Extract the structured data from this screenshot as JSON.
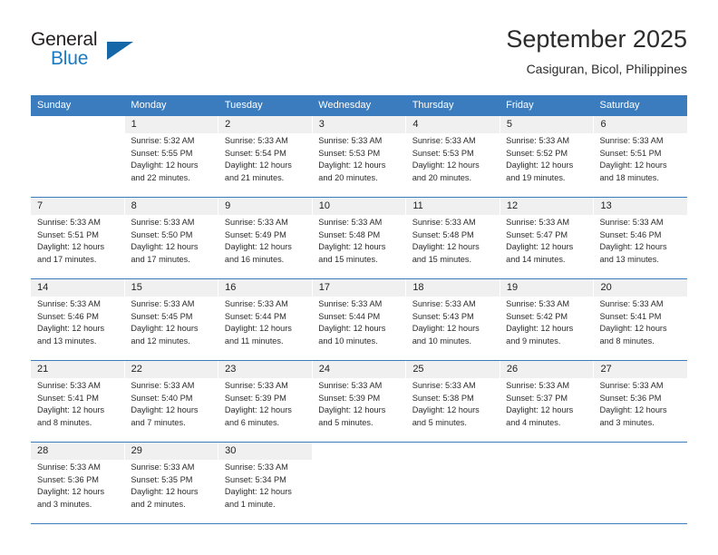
{
  "brand": {
    "word1": "General",
    "word2": "Blue",
    "triangle_color": "#1567a8",
    "blue_color": "#1c7ac0"
  },
  "header": {
    "title": "September 2025",
    "subtitle": "Casiguran, Bicol, Philippines"
  },
  "theme": {
    "header_band": "#3a7cbe",
    "daynum_band": "#f0f0f0",
    "text": "#2b2b2b"
  },
  "weekdays": [
    "Sunday",
    "Monday",
    "Tuesday",
    "Wednesday",
    "Thursday",
    "Friday",
    "Saturday"
  ],
  "weeks": [
    [
      {
        "day": "",
        "lines": []
      },
      {
        "day": "1",
        "lines": [
          "Sunrise: 5:32 AM",
          "Sunset: 5:55 PM",
          "Daylight: 12 hours",
          "and 22 minutes."
        ]
      },
      {
        "day": "2",
        "lines": [
          "Sunrise: 5:33 AM",
          "Sunset: 5:54 PM",
          "Daylight: 12 hours",
          "and 21 minutes."
        ]
      },
      {
        "day": "3",
        "lines": [
          "Sunrise: 5:33 AM",
          "Sunset: 5:53 PM",
          "Daylight: 12 hours",
          "and 20 minutes."
        ]
      },
      {
        "day": "4",
        "lines": [
          "Sunrise: 5:33 AM",
          "Sunset: 5:53 PM",
          "Daylight: 12 hours",
          "and 20 minutes."
        ]
      },
      {
        "day": "5",
        "lines": [
          "Sunrise: 5:33 AM",
          "Sunset: 5:52 PM",
          "Daylight: 12 hours",
          "and 19 minutes."
        ]
      },
      {
        "day": "6",
        "lines": [
          "Sunrise: 5:33 AM",
          "Sunset: 5:51 PM",
          "Daylight: 12 hours",
          "and 18 minutes."
        ]
      }
    ],
    [
      {
        "day": "7",
        "lines": [
          "Sunrise: 5:33 AM",
          "Sunset: 5:51 PM",
          "Daylight: 12 hours",
          "and 17 minutes."
        ]
      },
      {
        "day": "8",
        "lines": [
          "Sunrise: 5:33 AM",
          "Sunset: 5:50 PM",
          "Daylight: 12 hours",
          "and 17 minutes."
        ]
      },
      {
        "day": "9",
        "lines": [
          "Sunrise: 5:33 AM",
          "Sunset: 5:49 PM",
          "Daylight: 12 hours",
          "and 16 minutes."
        ]
      },
      {
        "day": "10",
        "lines": [
          "Sunrise: 5:33 AM",
          "Sunset: 5:48 PM",
          "Daylight: 12 hours",
          "and 15 minutes."
        ]
      },
      {
        "day": "11",
        "lines": [
          "Sunrise: 5:33 AM",
          "Sunset: 5:48 PM",
          "Daylight: 12 hours",
          "and 15 minutes."
        ]
      },
      {
        "day": "12",
        "lines": [
          "Sunrise: 5:33 AM",
          "Sunset: 5:47 PM",
          "Daylight: 12 hours",
          "and 14 minutes."
        ]
      },
      {
        "day": "13",
        "lines": [
          "Sunrise: 5:33 AM",
          "Sunset: 5:46 PM",
          "Daylight: 12 hours",
          "and 13 minutes."
        ]
      }
    ],
    [
      {
        "day": "14",
        "lines": [
          "Sunrise: 5:33 AM",
          "Sunset: 5:46 PM",
          "Daylight: 12 hours",
          "and 13 minutes."
        ]
      },
      {
        "day": "15",
        "lines": [
          "Sunrise: 5:33 AM",
          "Sunset: 5:45 PM",
          "Daylight: 12 hours",
          "and 12 minutes."
        ]
      },
      {
        "day": "16",
        "lines": [
          "Sunrise: 5:33 AM",
          "Sunset: 5:44 PM",
          "Daylight: 12 hours",
          "and 11 minutes."
        ]
      },
      {
        "day": "17",
        "lines": [
          "Sunrise: 5:33 AM",
          "Sunset: 5:44 PM",
          "Daylight: 12 hours",
          "and 10 minutes."
        ]
      },
      {
        "day": "18",
        "lines": [
          "Sunrise: 5:33 AM",
          "Sunset: 5:43 PM",
          "Daylight: 12 hours",
          "and 10 minutes."
        ]
      },
      {
        "day": "19",
        "lines": [
          "Sunrise: 5:33 AM",
          "Sunset: 5:42 PM",
          "Daylight: 12 hours",
          "and 9 minutes."
        ]
      },
      {
        "day": "20",
        "lines": [
          "Sunrise: 5:33 AM",
          "Sunset: 5:41 PM",
          "Daylight: 12 hours",
          "and 8 minutes."
        ]
      }
    ],
    [
      {
        "day": "21",
        "lines": [
          "Sunrise: 5:33 AM",
          "Sunset: 5:41 PM",
          "Daylight: 12 hours",
          "and 8 minutes."
        ]
      },
      {
        "day": "22",
        "lines": [
          "Sunrise: 5:33 AM",
          "Sunset: 5:40 PM",
          "Daylight: 12 hours",
          "and 7 minutes."
        ]
      },
      {
        "day": "23",
        "lines": [
          "Sunrise: 5:33 AM",
          "Sunset: 5:39 PM",
          "Daylight: 12 hours",
          "and 6 minutes."
        ]
      },
      {
        "day": "24",
        "lines": [
          "Sunrise: 5:33 AM",
          "Sunset: 5:39 PM",
          "Daylight: 12 hours",
          "and 5 minutes."
        ]
      },
      {
        "day": "25",
        "lines": [
          "Sunrise: 5:33 AM",
          "Sunset: 5:38 PM",
          "Daylight: 12 hours",
          "and 5 minutes."
        ]
      },
      {
        "day": "26",
        "lines": [
          "Sunrise: 5:33 AM",
          "Sunset: 5:37 PM",
          "Daylight: 12 hours",
          "and 4 minutes."
        ]
      },
      {
        "day": "27",
        "lines": [
          "Sunrise: 5:33 AM",
          "Sunset: 5:36 PM",
          "Daylight: 12 hours",
          "and 3 minutes."
        ]
      }
    ],
    [
      {
        "day": "28",
        "lines": [
          "Sunrise: 5:33 AM",
          "Sunset: 5:36 PM",
          "Daylight: 12 hours",
          "and 3 minutes."
        ]
      },
      {
        "day": "29",
        "lines": [
          "Sunrise: 5:33 AM",
          "Sunset: 5:35 PM",
          "Daylight: 12 hours",
          "and 2 minutes."
        ]
      },
      {
        "day": "30",
        "lines": [
          "Sunrise: 5:33 AM",
          "Sunset: 5:34 PM",
          "Daylight: 12 hours",
          "and 1 minute."
        ]
      },
      {
        "day": "",
        "lines": []
      },
      {
        "day": "",
        "lines": []
      },
      {
        "day": "",
        "lines": []
      },
      {
        "day": "",
        "lines": []
      }
    ]
  ]
}
